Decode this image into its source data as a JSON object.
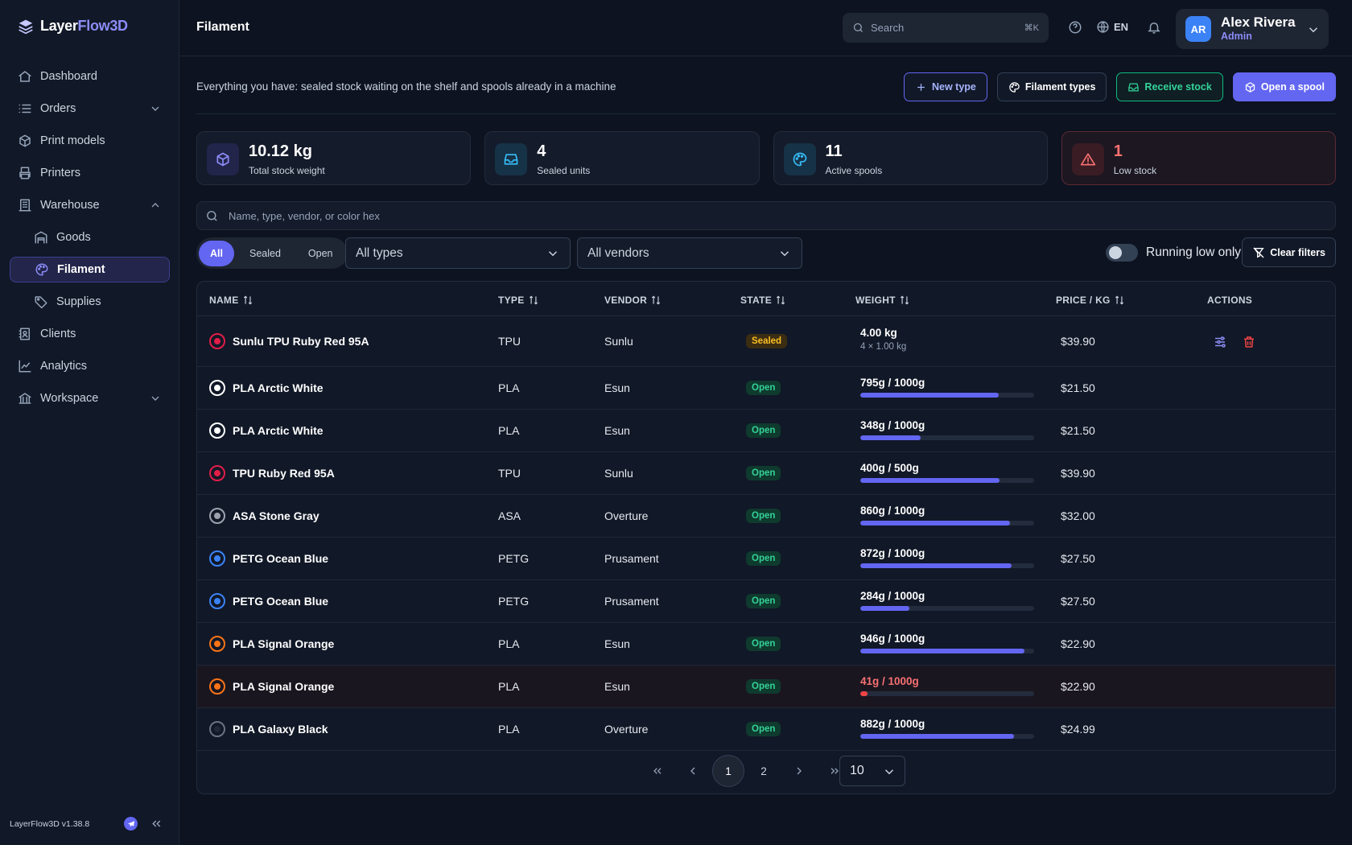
{
  "app": {
    "brand_a": "Layer",
    "brand_b": "Flow3D",
    "version": "LayerFlow3D v1.38.8"
  },
  "sidebar": {
    "items": [
      {
        "label": "Dashboard",
        "icon": "home-icon"
      },
      {
        "label": "Orders",
        "icon": "list-icon",
        "expandable": true
      },
      {
        "label": "Print models",
        "icon": "box-icon"
      },
      {
        "label": "Printers",
        "icon": "printer-icon"
      },
      {
        "label": "Warehouse",
        "icon": "building-icon",
        "expanded": true
      },
      {
        "label": "Goods",
        "icon": "warehouse-icon",
        "sub": true
      },
      {
        "label": "Filament",
        "icon": "palette-icon",
        "sub": true,
        "active": true
      },
      {
        "label": "Supplies",
        "icon": "tag-icon",
        "sub": true
      },
      {
        "label": "Clients",
        "icon": "contacts-icon"
      },
      {
        "label": "Analytics",
        "icon": "chart-icon"
      },
      {
        "label": "Workspace",
        "icon": "bank-icon",
        "expandable": true
      }
    ]
  },
  "header": {
    "title": "Filament",
    "search_placeholder": "Search",
    "search_shortcut": "⌘K",
    "language": "EN",
    "user": {
      "initials": "AR",
      "name": "Alex Rivera",
      "role": "Admin"
    }
  },
  "page": {
    "description": "Everything you have: sealed stock waiting on the shelf and spools already in a machine",
    "actions": {
      "new_type": "New type",
      "filament_types": "Filament types",
      "receive_stock": "Receive stock",
      "open_spool": "Open a spool"
    },
    "stats": [
      {
        "value": "10.12 kg",
        "label": "Total stock weight",
        "icon": "cube-icon",
        "color": "#8b8cf7"
      },
      {
        "value": "4",
        "label": "Sealed units",
        "icon": "inbox-icon",
        "color": "#38bdf8"
      },
      {
        "value": "11",
        "label": "Active spools",
        "icon": "palette-icon",
        "color": "#38bdf8"
      },
      {
        "value": "1",
        "label": "Low stock",
        "icon": "warning-icon",
        "color": "#f87171"
      }
    ],
    "filter_placeholder": "Name, type, vendor, or color hex",
    "segments": [
      "All",
      "Sealed",
      "Open"
    ],
    "type_select": "All types",
    "vendor_select": "All vendors",
    "running_low_label": "Running low only",
    "clear_filters": "Clear filters"
  },
  "table": {
    "columns": [
      "NAME",
      "TYPE",
      "VENDOR",
      "STATE",
      "WEIGHT",
      "PRICE / KG",
      "ACTIONS"
    ],
    "rows": [
      {
        "name": "Sunlu TPU Ruby Red 95A",
        "type": "TPU",
        "vendor": "Sunlu",
        "state": "Sealed",
        "weight": "4.00 kg",
        "weight_sub": "4 × 1.00 kg",
        "price": "$39.90",
        "color": "#e11d48",
        "actions": true
      },
      {
        "name": "PLA Arctic White",
        "type": "PLA",
        "vendor": "Esun",
        "state": "Open",
        "weight": "795g / 1000g",
        "fill": 0.795,
        "price": "$21.50",
        "color": "#ffffff"
      },
      {
        "name": "PLA Arctic White",
        "type": "PLA",
        "vendor": "Esun",
        "state": "Open",
        "weight": "348g / 1000g",
        "fill": 0.348,
        "price": "$21.50",
        "color": "#ffffff"
      },
      {
        "name": "TPU Ruby Red 95A",
        "type": "TPU",
        "vendor": "Sunlu",
        "state": "Open",
        "weight": "400g / 500g",
        "fill": 0.8,
        "price": "$39.90",
        "color": "#e11d48"
      },
      {
        "name": "ASA Stone Gray",
        "type": "ASA",
        "vendor": "Overture",
        "state": "Open",
        "weight": "860g / 1000g",
        "fill": 0.86,
        "price": "$32.00",
        "color": "#9ca3af"
      },
      {
        "name": "PETG Ocean Blue",
        "type": "PETG",
        "vendor": "Prusament",
        "state": "Open",
        "weight": "872g / 1000g",
        "fill": 0.872,
        "price": "$27.50",
        "color": "#3b82f6"
      },
      {
        "name": "PETG Ocean Blue",
        "type": "PETG",
        "vendor": "Prusament",
        "state": "Open",
        "weight": "284g / 1000g",
        "fill": 0.284,
        "price": "$27.50",
        "color": "#3b82f6"
      },
      {
        "name": "PLA Signal Orange",
        "type": "PLA",
        "vendor": "Esun",
        "state": "Open",
        "weight": "946g / 1000g",
        "fill": 0.946,
        "price": "$22.90",
        "color": "#f97316"
      },
      {
        "name": "PLA Signal Orange",
        "type": "PLA",
        "vendor": "Esun",
        "state": "Open",
        "weight": "41g / 1000g",
        "fill": 0.041,
        "price": "$22.90",
        "color": "#f97316",
        "low": true
      },
      {
        "name": "PLA Galaxy Black",
        "type": "PLA",
        "vendor": "Overture",
        "state": "Open",
        "weight": "882g / 1000g",
        "fill": 0.882,
        "price": "$24.99",
        "color": "#1f2937"
      }
    ]
  },
  "pagination": {
    "pages": [
      "1",
      "2"
    ],
    "current": "1",
    "per_page": "10"
  }
}
